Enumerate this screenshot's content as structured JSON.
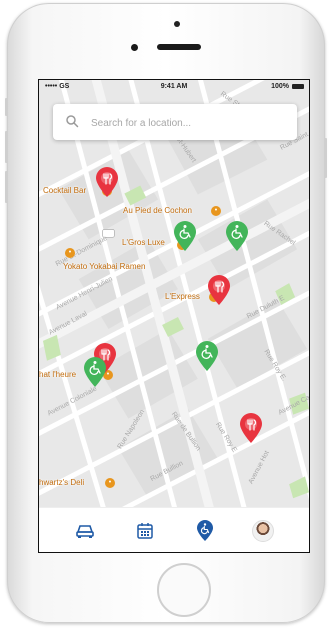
{
  "status_bar": {
    "carrier": "••••• GS",
    "time": "9:41 AM",
    "battery": "100%"
  },
  "search": {
    "placeholder": "Search for a location...",
    "icon": "search-icon"
  },
  "places": [
    {
      "name": "Cocktail Bar"
    },
    {
      "name": "Au Pied de Cochon"
    },
    {
      "name": "L'Gros Luxe"
    },
    {
      "name": "Yokato Yokabai Ramen"
    },
    {
      "name": "L'Express"
    },
    {
      "name": "hat l'heure"
    },
    {
      "name": "hwartz's Deli"
    }
  ],
  "streets": [
    "Rue St-Hubert",
    "Rue Rachel",
    "Avenue Henri-Julien",
    "Avenue Laval",
    "Avenue Coloniale",
    "Rue Napoleon",
    "Rue de Bullion",
    "Rue Saint",
    "Rue Roy E.",
    "Rue Roy E",
    "Rue Duluth E",
    "Rue Bullion",
    "Avenue Hot",
    "Rue St",
    "Avenue Ca",
    "Rue St-Dominique"
  ],
  "pins": [
    {
      "type": "restaurant",
      "color": "#e8343f"
    },
    {
      "type": "accessible",
      "color": "#43b55a"
    },
    {
      "type": "accessible",
      "color": "#43b55a"
    },
    {
      "type": "restaurant",
      "color": "#e8343f"
    },
    {
      "type": "accessible",
      "color": "#43b55a"
    },
    {
      "type": "restaurant",
      "color": "#e8343f"
    },
    {
      "type": "accessible",
      "color": "#43b55a"
    },
    {
      "type": "restaurant",
      "color": "#e8343f"
    }
  ],
  "bottom_nav": [
    {
      "icon": "car-icon",
      "active": false
    },
    {
      "icon": "calendar-icon",
      "active": false
    },
    {
      "icon": "accessibility-pin-icon",
      "active": true
    },
    {
      "icon": "profile-avatar",
      "active": false
    }
  ],
  "colors": {
    "accent": "#1f5aa6",
    "pin_red": "#e8343f",
    "pin_green": "#43b55a",
    "poi_orange": "#e8961e",
    "map_bg": "#e8e8e8",
    "park_green": "#c8e6b2"
  }
}
